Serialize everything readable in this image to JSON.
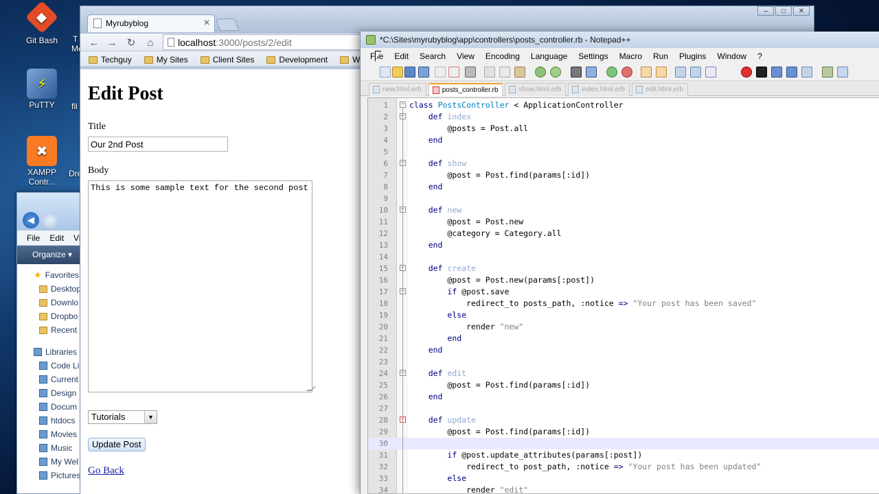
{
  "desktop": {
    "icons": [
      {
        "label": "Git Bash",
        "glyph": "◆"
      },
      {
        "label": "PuTTY",
        "glyph": "⚡"
      },
      {
        "label": "XAMPP Contr...",
        "glyph": "✖"
      }
    ],
    "partial_labels": [
      "T",
      "Me",
      "fil",
      "Dre"
    ]
  },
  "explorer": {
    "menu": [
      "File",
      "Edit",
      "Vi"
    ],
    "organize_label": "Organize ▾",
    "favorites_label": "Favorites",
    "favorites": [
      "Desktop",
      "Downlo",
      "Dropbo",
      "Recent"
    ],
    "libraries_label": "Libraries",
    "libraries": [
      "Code Li",
      "Current",
      "Design",
      "Docum",
      "htdocs",
      "Movies",
      "Music",
      "My Wel",
      "Pictures"
    ]
  },
  "browser": {
    "tab_title": "Myrubyblog",
    "url_host": "localhost",
    "url_path": ":3000/posts/2/edit",
    "bookmarks": [
      "Techguy",
      "My Sites",
      "Client Sites",
      "Development",
      "Web Hos"
    ],
    "page": {
      "heading": "Edit Post",
      "title_label": "Title",
      "title_value": "Our 2nd Post",
      "body_label": "Body",
      "body_value": "This is some sample text for the second post",
      "category_selected": "Tutorials",
      "submit_label": "Update Post",
      "back_link": "Go Back"
    }
  },
  "notepad": {
    "title": "*C:\\Sites\\myrubyblog\\app\\controllers\\posts_controller.rb - Notepad++",
    "menu": [
      "File",
      "Edit",
      "Search",
      "View",
      "Encoding",
      "Language",
      "Settings",
      "Macro",
      "Run",
      "Plugins",
      "Window",
      "?"
    ],
    "tabs": [
      "new.html.erb",
      "posts_controller.rb",
      "show.html.erb",
      "index.html.erb",
      "edit.html.erb"
    ],
    "active_tab": "posts_controller.rb",
    "current_line": 30,
    "lines": [
      {
        "n": "1",
        "text": "class PostsController < ApplicationController"
      },
      {
        "n": "2",
        "text": "    def index"
      },
      {
        "n": "3",
        "text": "        @posts = Post.all"
      },
      {
        "n": "4",
        "text": "    end"
      },
      {
        "n": "5",
        "text": ""
      },
      {
        "n": "6",
        "text": "    def show"
      },
      {
        "n": "7",
        "text": "        @post = Post.find(params[:id])"
      },
      {
        "n": "8",
        "text": "    end"
      },
      {
        "n": "9",
        "text": ""
      },
      {
        "n": "10",
        "text": "    def new"
      },
      {
        "n": "11",
        "text": "        @post = Post.new"
      },
      {
        "n": "12",
        "text": "        @category = Category.all"
      },
      {
        "n": "13",
        "text": "    end"
      },
      {
        "n": "14",
        "text": ""
      },
      {
        "n": "15",
        "text": "    def create"
      },
      {
        "n": "16",
        "text": "        @post = Post.new(params[:post])"
      },
      {
        "n": "17",
        "text": "        if @post.save"
      },
      {
        "n": "18",
        "text": "            redirect_to posts_path, :notice => \"Your post has been saved\""
      },
      {
        "n": "19",
        "text": "        else"
      },
      {
        "n": "20",
        "text": "            render \"new\""
      },
      {
        "n": "21",
        "text": "        end"
      },
      {
        "n": "22",
        "text": "    end"
      },
      {
        "n": "23",
        "text": ""
      },
      {
        "n": "24",
        "text": "    def edit"
      },
      {
        "n": "25",
        "text": "        @post = Post.find(params[:id])"
      },
      {
        "n": "26",
        "text": "    end"
      },
      {
        "n": "27",
        "text": ""
      },
      {
        "n": "28",
        "text": "    def update"
      },
      {
        "n": "29",
        "text": "        @post = Post.find(params[:id])"
      },
      {
        "n": "30",
        "text": ""
      },
      {
        "n": "31",
        "text": "        if @post.update_attributes(params[:post])"
      },
      {
        "n": "32",
        "text": "            redirect_to post_path, :notice => \"Your post has been updated\""
      },
      {
        "n": "33",
        "text": "        else"
      },
      {
        "n": "34",
        "text": "            render \"edit\""
      }
    ]
  }
}
